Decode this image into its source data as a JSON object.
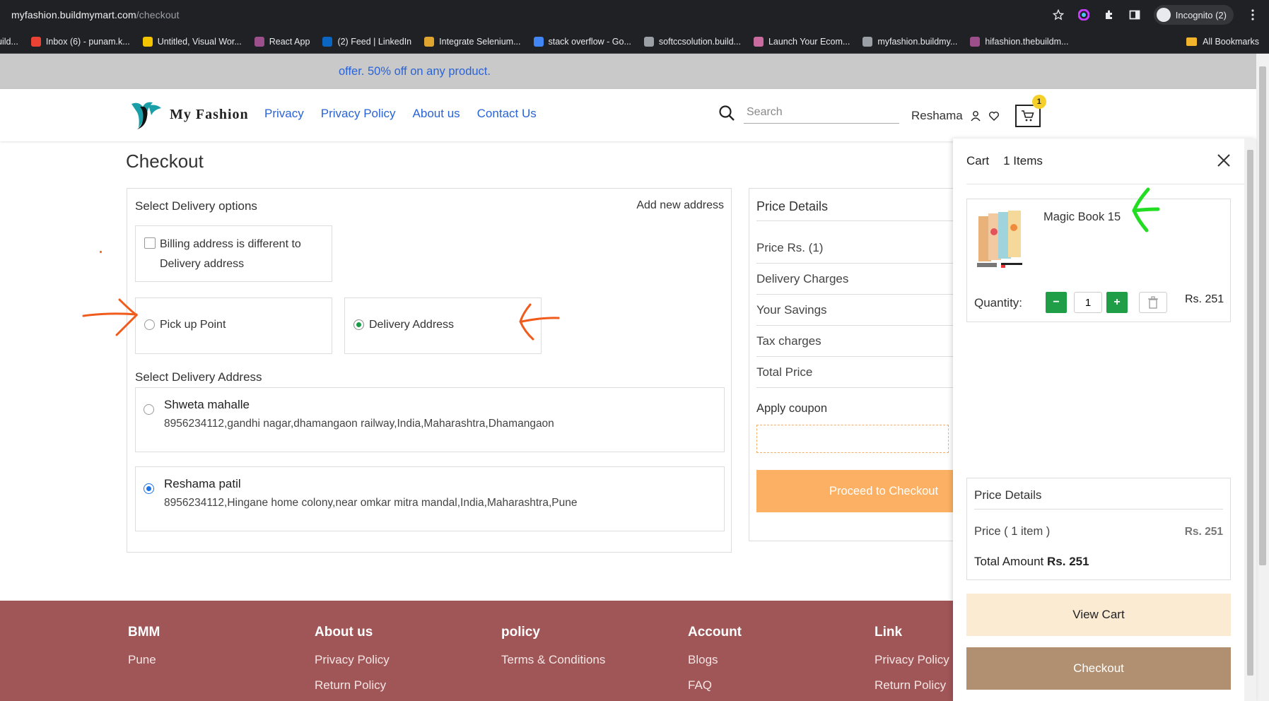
{
  "browser": {
    "url_host": "myfashion.buildmymart.com",
    "url_path": "/checkout",
    "profile_label": "Incognito (2)",
    "all_bookmarks_label": "All Bookmarks",
    "bookmarks": [
      {
        "label": "uild...",
        "color": "#5f6368"
      },
      {
        "label": "Inbox (6) - punam.k...",
        "color": "#ea4335"
      },
      {
        "label": "Untitled, Visual Wor...",
        "color": "#f5c400"
      },
      {
        "label": "React App",
        "color": "#9c4f8a"
      },
      {
        "label": "(2) Feed | LinkedIn",
        "color": "#0a66c2"
      },
      {
        "label": "Integrate Selenium...",
        "color": "#e0a52f"
      },
      {
        "label": "stack overflow - Go...",
        "color": "#4285f4"
      },
      {
        "label": "softccsolution.build...",
        "color": "#9aa0a6"
      },
      {
        "label": "Launch Your Ecom...",
        "color": "#c96b9e"
      },
      {
        "label": "myfashion.buildmy...",
        "color": "#9aa0a6"
      },
      {
        "label": "hifashion.thebuildm...",
        "color": "#9c4f8a"
      }
    ]
  },
  "promo": {
    "text": "offer. 50% off on any product."
  },
  "header": {
    "brand": "My Fashion",
    "nav": [
      "Privacy",
      "Privacy Policy",
      "About us",
      "Contact Us"
    ],
    "search_placeholder": "Search",
    "username": "Reshama",
    "cart_count": "1"
  },
  "checkout": {
    "title": "Checkout",
    "delivery_options_heading": "Select Delivery options",
    "add_new_address": "Add new address",
    "billing_label": "Billing address is different to Delivery address",
    "pickup_label": "Pick up Point",
    "delivery_address_label": "Delivery Address",
    "select_address_heading": "Select Delivery Address",
    "addresses": [
      {
        "name": "Shweta mahalle",
        "line": "8956234112,gandhi nagar,dhamangaon railway,India,Maharashtra,Dhamangaon",
        "selected": false
      },
      {
        "name": "Reshama patil",
        "line": "8956234112,Hingane home colony,near omkar mitra mandal,India,Maharashtra,Pune",
        "selected": true
      }
    ]
  },
  "price_details": {
    "heading": "Price Details",
    "rows": [
      "Price Rs. (1)",
      "Delivery Charges",
      "Your Savings",
      "Tax charges",
      "Total Price"
    ],
    "apply_coupon": "Apply coupon",
    "proceed_label": "Proceed to Checkout"
  },
  "cart_drawer": {
    "title": "Cart",
    "count_label": "1 Items",
    "item": {
      "name": "Magic Book 15",
      "qty_label": "Quantity:",
      "qty": "1",
      "price": "Rs. 251"
    },
    "summary": {
      "heading": "Price Details",
      "price_label": "Price ( 1 item )",
      "price_value": "Rs. 251",
      "total_label": "Total Amount",
      "total_value": "Rs. 251"
    },
    "view_cart": "View Cart",
    "checkout": "Checkout"
  },
  "footer": {
    "columns": [
      {
        "heading": "BMM",
        "links": [
          "Pune"
        ]
      },
      {
        "heading": "About us",
        "links": [
          "Privacy Policy",
          "Return Policy"
        ]
      },
      {
        "heading": "policy",
        "links": [
          "Terms & Conditions"
        ]
      },
      {
        "heading": "Account",
        "links": [
          "Blogs",
          "FAQ"
        ]
      },
      {
        "heading": "Link",
        "links": [
          "Privacy Policy",
          "Return Policy"
        ]
      }
    ]
  },
  "colors": {
    "promo_bg": "#c9c9c9",
    "link_blue": "#2a63d6",
    "proceed_orange": "#fbb063",
    "footer_bg": "#a05557",
    "qty_green": "#1f9d47",
    "checkout_brown": "#b09071",
    "view_cart_bg": "#fbebd3",
    "annotation_orange": "#f05a1a",
    "annotation_green": "#22dd22"
  }
}
